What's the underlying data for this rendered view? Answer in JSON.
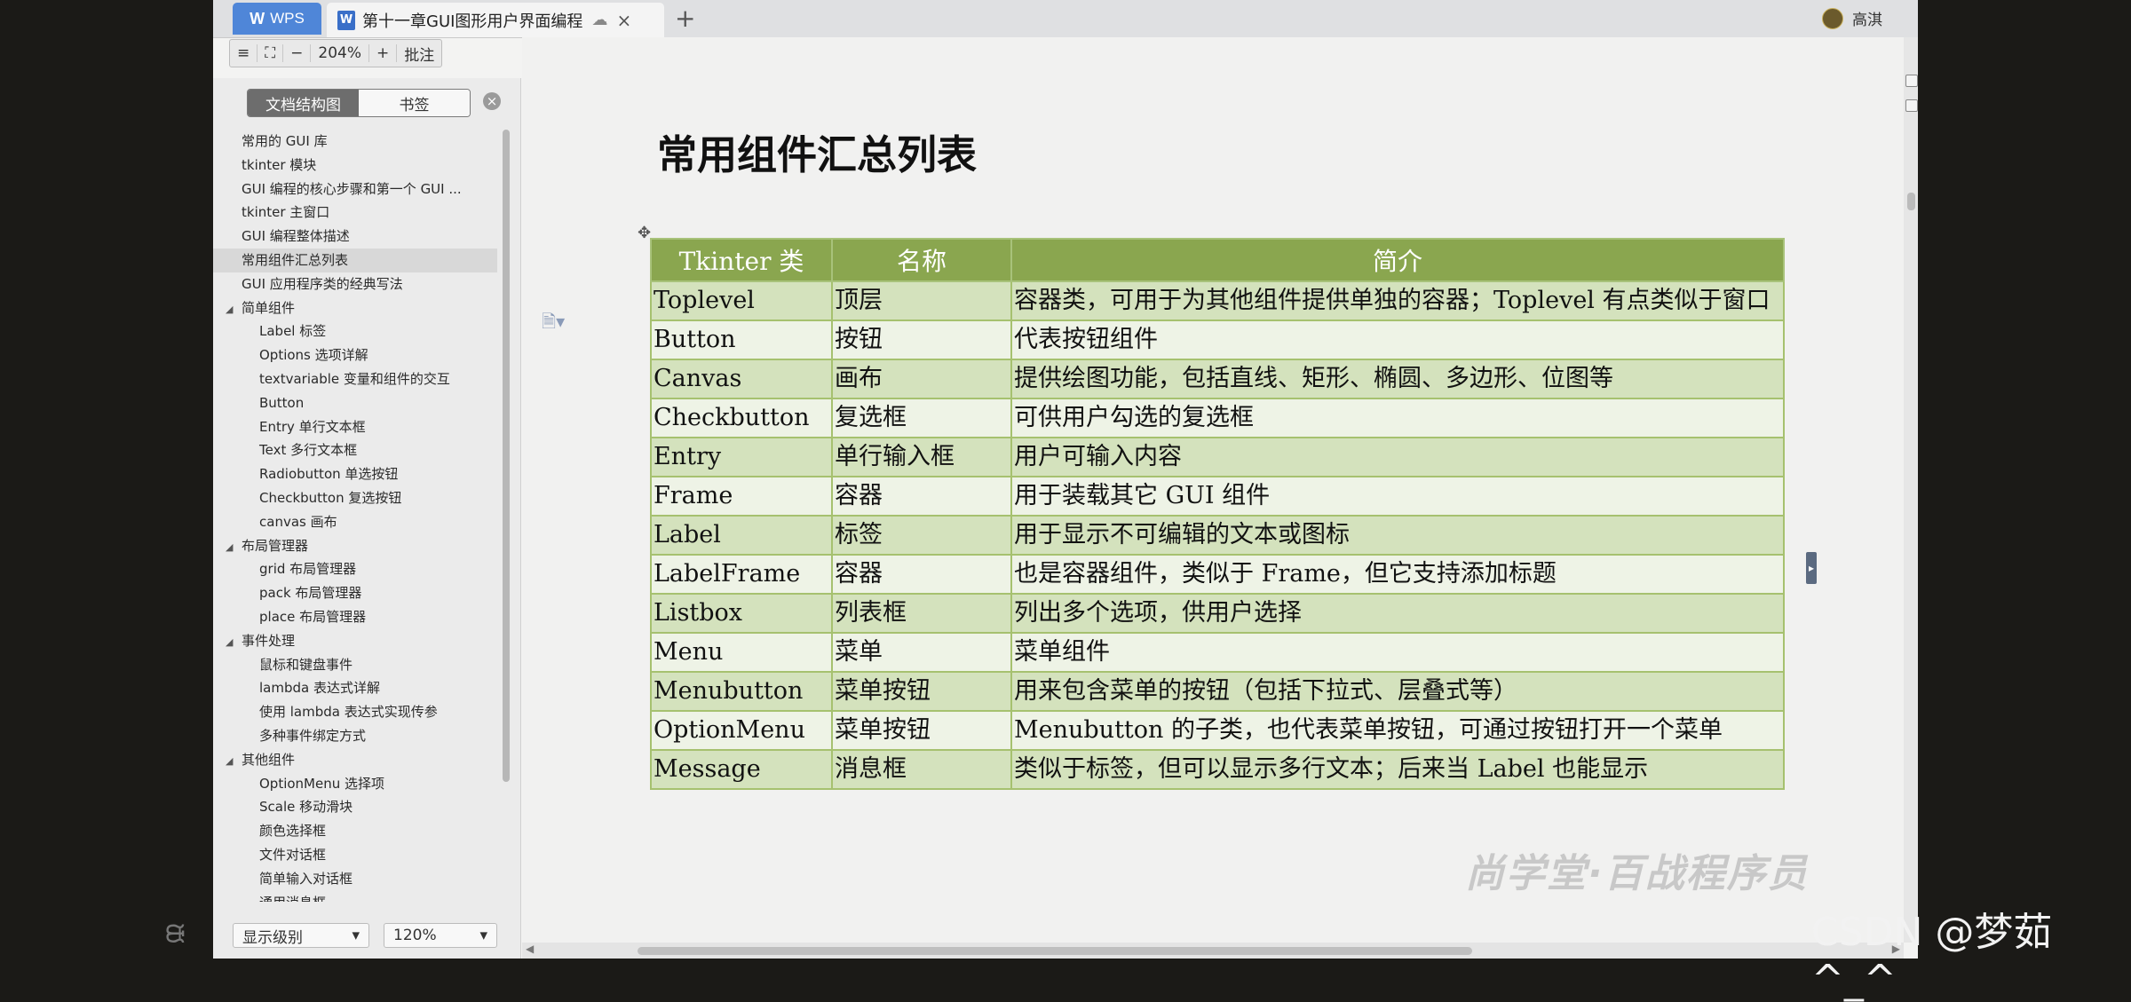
{
  "tabs": {
    "wps_label": "WPS",
    "doc_icon": "W",
    "doc_title": "第十一章GUI图形用户界面编程",
    "new_tab": "+",
    "user_name": "高淇"
  },
  "zoom_toolbar": {
    "menu": "≡",
    "fit": "⛶",
    "minus": "−",
    "value": "204%",
    "plus": "+",
    "comment": "批注"
  },
  "nav": {
    "tab_outline": "文档结构图",
    "tab_bookmarks": "书签",
    "items": [
      {
        "label": "常用的 GUI 库",
        "level": 1
      },
      {
        "label": "tkinter 模块",
        "level": 1
      },
      {
        "label": "GUI 编程的核心步骤和第一个 GUI ...",
        "level": 1
      },
      {
        "label": "tkinter 主窗口",
        "level": 1
      },
      {
        "label": "GUI 编程整体描述",
        "level": 1
      },
      {
        "label": "常用组件汇总列表",
        "level": 1,
        "selected": true
      },
      {
        "label": "GUI 应用程序类的经典写法",
        "level": 1
      },
      {
        "label": "简单组件",
        "level": 1,
        "expanded": true
      },
      {
        "label": "Label 标签",
        "level": 2
      },
      {
        "label": "Options 选项详解",
        "level": 2
      },
      {
        "label": "textvariable 变量和组件的交互",
        "level": 2
      },
      {
        "label": "Button",
        "level": 2
      },
      {
        "label": "Entry 单行文本框",
        "level": 2
      },
      {
        "label": "Text 多行文本框",
        "level": 2
      },
      {
        "label": "Radiobutton 单选按钮",
        "level": 2
      },
      {
        "label": "Checkbutton 复选按钮",
        "level": 2
      },
      {
        "label": "canvas 画布",
        "level": 2
      },
      {
        "label": "布局管理器",
        "level": 1,
        "expanded": true
      },
      {
        "label": "grid 布局管理器",
        "level": 2
      },
      {
        "label": "pack 布局管理器",
        "level": 2
      },
      {
        "label": "place 布局管理器",
        "level": 2
      },
      {
        "label": "事件处理",
        "level": 1,
        "expanded": true
      },
      {
        "label": "鼠标和键盘事件",
        "level": 2
      },
      {
        "label": "lambda 表达式详解",
        "level": 2
      },
      {
        "label": "使用 lambda 表达式实现传参",
        "level": 2
      },
      {
        "label": "多种事件绑定方式",
        "level": 2
      },
      {
        "label": "其他组件",
        "level": 1,
        "expanded": true
      },
      {
        "label": "OptionMenu 选择项",
        "level": 2
      },
      {
        "label": "Scale 移动滑块",
        "level": 2
      },
      {
        "label": "颜色选择框",
        "level": 2
      },
      {
        "label": "文件对话框",
        "level": 2
      },
      {
        "label": "简单输入对话框",
        "level": 2
      },
      {
        "label": "通用消息框",
        "level": 2
      }
    ],
    "level_select": "显示级别",
    "zoom_select": "120%"
  },
  "document": {
    "title": "常用组件汇总列表",
    "headers": [
      "Tkinter 类",
      "名称",
      "简介"
    ],
    "rows": [
      [
        "Toplevel",
        "顶层",
        "容器类，可用于为其他组件提供单独的容器；Toplevel 有点类似于窗口"
      ],
      [
        "Button",
        "按钮",
        "代表按钮组件"
      ],
      [
        "Canvas",
        "画布",
        "提供绘图功能，包括直线、矩形、椭圆、多边形、位图等"
      ],
      [
        "Checkbutton",
        "复选框",
        "可供用户勾选的复选框"
      ],
      [
        "Entry",
        "单行输入框",
        "用户可输入内容"
      ],
      [
        "Frame",
        "容器",
        "用于装载其它 GUI 组件"
      ],
      [
        "Label",
        "标签",
        "用于显示不可编辑的文本或图标"
      ],
      [
        "LabelFrame",
        "容器",
        "也是容器组件，类似于 Frame，但它支持添加标题"
      ],
      [
        "Listbox",
        "列表框",
        "列出多个选项，供用户选择"
      ],
      [
        "Menu",
        "菜单",
        "菜单组件"
      ],
      [
        "Menubutton",
        "菜单按钮",
        "用来包含菜单的按钮（包括下拉式、层叠式等）"
      ],
      [
        "OptionMenu",
        "菜单按钮",
        "Menubutton 的子类，也代表菜单按钮，可通过按钮打开一个菜单"
      ],
      [
        "Message",
        "消息框",
        "类似于标签，但可以显示多行文本；后来当 Label 也能显示"
      ]
    ]
  },
  "overlay": {
    "watermark": "尚学堂·百战程序员",
    "csdn": "CSDN @梦茹^_^"
  },
  "colors": {
    "header_green": "#8aa64f",
    "row_odd": "#d4e2bd",
    "row_even": "#eef3e6",
    "wps_blue": "#4f86d8"
  }
}
